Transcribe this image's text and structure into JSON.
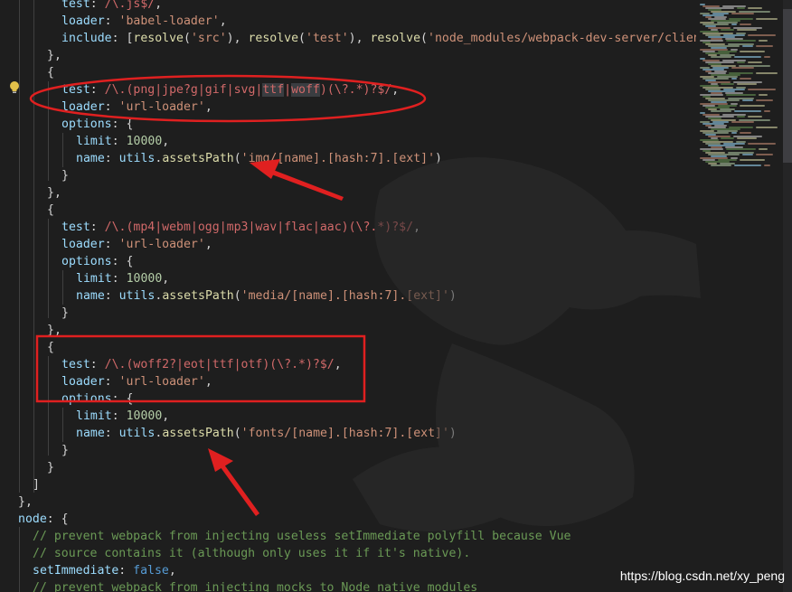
{
  "colors": {
    "background": "#1e1e1e",
    "property": "#9cdcfe",
    "string": "#ce9178",
    "number": "#b5cea8",
    "function": "#dcdcaa",
    "comment": "#6a9955",
    "keyword": "#569cd6",
    "annotation_red": "#e02020"
  },
  "gutter": {
    "lightbulb_icon": "lightbulb-icon"
  },
  "code": [
    [
      [
        "    ",
        "p"
      ],
      [
        "test",
        "k"
      ],
      [
        ": ",
        "p"
      ],
      [
        "/\\.js$/",
        "r"
      ],
      [
        ",",
        "p"
      ]
    ],
    [
      [
        "    ",
        "p"
      ],
      [
        "loader",
        "k"
      ],
      [
        ": ",
        "p"
      ],
      [
        "'babel-loader'",
        "s"
      ],
      [
        ",",
        "p"
      ]
    ],
    [
      [
        "    ",
        "p"
      ],
      [
        "include",
        "k"
      ],
      [
        ": [",
        "p"
      ],
      [
        "resolve",
        "f"
      ],
      [
        "(",
        "p"
      ],
      [
        "'src'",
        "s"
      ],
      [
        "), ",
        "p"
      ],
      [
        "resolve",
        "f"
      ],
      [
        "(",
        "p"
      ],
      [
        "'test'",
        "s"
      ],
      [
        "), ",
        "p"
      ],
      [
        "resolve",
        "f"
      ],
      [
        "(",
        "p"
      ],
      [
        "'node_modules/webpack-dev-server/client'",
        "s"
      ],
      [
        ")]",
        "p"
      ]
    ],
    [
      [
        "  },",
        "p"
      ]
    ],
    [
      [
        "  {",
        "p"
      ]
    ],
    [
      [
        "    ",
        "p"
      ],
      [
        "test",
        "k"
      ],
      [
        ": ",
        "p"
      ],
      [
        "/\\.(png|jpe?g|gif|svg|",
        "r"
      ],
      [
        "ttf",
        "r hl"
      ],
      [
        "|",
        "r"
      ],
      [
        "woff",
        "r hl"
      ],
      [
        ")(\\?.*)?$/",
        "r"
      ],
      [
        ",",
        "p"
      ]
    ],
    [
      [
        "    ",
        "p"
      ],
      [
        "loader",
        "k"
      ],
      [
        ": ",
        "p"
      ],
      [
        "'url-loader'",
        "s"
      ],
      [
        ",",
        "p"
      ]
    ],
    [
      [
        "    ",
        "p"
      ],
      [
        "options",
        "k"
      ],
      [
        ": {",
        "p"
      ]
    ],
    [
      [
        "      ",
        "p"
      ],
      [
        "limit",
        "k"
      ],
      [
        ": ",
        "p"
      ],
      [
        "10000",
        "n"
      ],
      [
        ",",
        "p"
      ]
    ],
    [
      [
        "      ",
        "p"
      ],
      [
        "name",
        "k"
      ],
      [
        ": ",
        "p"
      ],
      [
        "utils",
        "k"
      ],
      [
        ".",
        "p"
      ],
      [
        "assetsPath",
        "f"
      ],
      [
        "(",
        "p"
      ],
      [
        "'img/[name].[hash:7].[ext]'",
        "s"
      ],
      [
        ")",
        "p"
      ]
    ],
    [
      [
        "    }",
        "p"
      ]
    ],
    [
      [
        "  },",
        "p"
      ]
    ],
    [
      [
        "  {",
        "p"
      ]
    ],
    [
      [
        "    ",
        "p"
      ],
      [
        "test",
        "k"
      ],
      [
        ": ",
        "p"
      ],
      [
        "/\\.(mp4|webm|ogg|mp3|wav|flac|aac)(\\?.*)?$/",
        "r"
      ],
      [
        ",",
        "p"
      ]
    ],
    [
      [
        "    ",
        "p"
      ],
      [
        "loader",
        "k"
      ],
      [
        ": ",
        "p"
      ],
      [
        "'url-loader'",
        "s"
      ],
      [
        ",",
        "p"
      ]
    ],
    [
      [
        "    ",
        "p"
      ],
      [
        "options",
        "k"
      ],
      [
        ": {",
        "p"
      ]
    ],
    [
      [
        "      ",
        "p"
      ],
      [
        "limit",
        "k"
      ],
      [
        ": ",
        "p"
      ],
      [
        "10000",
        "n"
      ],
      [
        ",",
        "p"
      ]
    ],
    [
      [
        "      ",
        "p"
      ],
      [
        "name",
        "k"
      ],
      [
        ": ",
        "p"
      ],
      [
        "utils",
        "k"
      ],
      [
        ".",
        "p"
      ],
      [
        "assetsPath",
        "f"
      ],
      [
        "(",
        "p"
      ],
      [
        "'media/[name].[hash:7].[ext]'",
        "s"
      ],
      [
        ")",
        "p"
      ]
    ],
    [
      [
        "    }",
        "p"
      ]
    ],
    [
      [
        "  },",
        "p"
      ]
    ],
    [
      [
        "  {",
        "p"
      ]
    ],
    [
      [
        "    ",
        "p"
      ],
      [
        "test",
        "k"
      ],
      [
        ": ",
        "p"
      ],
      [
        "/\\.(woff2?|eot|ttf|otf)(\\?.*)?$/",
        "r"
      ],
      [
        ",",
        "p"
      ]
    ],
    [
      [
        "    ",
        "p"
      ],
      [
        "loader",
        "k"
      ],
      [
        ": ",
        "p"
      ],
      [
        "'url-loader'",
        "s"
      ],
      [
        ",",
        "p"
      ]
    ],
    [
      [
        "    ",
        "p"
      ],
      [
        "options",
        "k"
      ],
      [
        ": {",
        "p"
      ]
    ],
    [
      [
        "      ",
        "p"
      ],
      [
        "limit",
        "k"
      ],
      [
        ": ",
        "p"
      ],
      [
        "10000",
        "n"
      ],
      [
        ",",
        "p"
      ]
    ],
    [
      [
        "      ",
        "p"
      ],
      [
        "name",
        "k"
      ],
      [
        ": ",
        "p"
      ],
      [
        "utils",
        "k"
      ],
      [
        ".",
        "p"
      ],
      [
        "assetsPath",
        "f"
      ],
      [
        "(",
        "p"
      ],
      [
        "'fonts/[name].[hash:7].[ext]'",
        "s"
      ],
      [
        ")",
        "p"
      ]
    ],
    [
      [
        "    }",
        "p"
      ]
    ],
    [
      [
        "  }",
        "p"
      ]
    ],
    [
      [
        "]",
        "p"
      ]
    ],
    [
      [
        "},",
        "p"
      ]
    ],
    [
      [
        "node",
        "k"
      ],
      [
        ": {",
        "p"
      ]
    ],
    [
      [
        "  ",
        "p"
      ],
      [
        "// prevent webpack from injecting useless setImmediate polyfill because Vue",
        "c"
      ]
    ],
    [
      [
        "  ",
        "p"
      ],
      [
        "// source contains it (although only uses it if it's native).",
        "c"
      ]
    ],
    [
      [
        "  ",
        "p"
      ],
      [
        "setImmediate",
        "k"
      ],
      [
        ": ",
        "p"
      ],
      [
        "false",
        "b"
      ],
      [
        ",",
        "p"
      ]
    ],
    [
      [
        "  ",
        "p"
      ],
      [
        "// prevent webpack from injecting mocks to Node native modules",
        "c"
      ]
    ]
  ],
  "watermark": "https://blog.csdn.net/xy_peng"
}
